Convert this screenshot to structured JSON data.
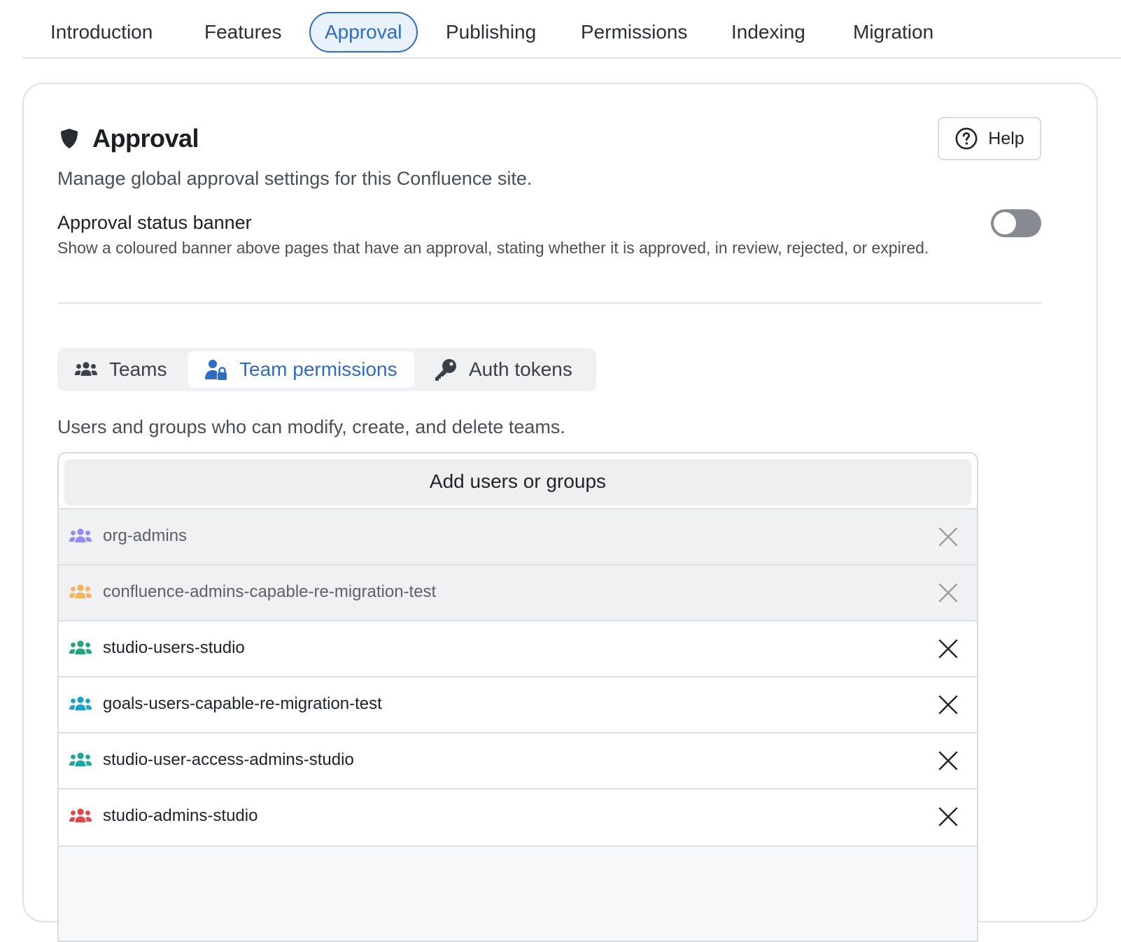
{
  "nav": {
    "tabs": [
      {
        "label": "Introduction"
      },
      {
        "label": "Features"
      },
      {
        "label": "Approval",
        "active": true
      },
      {
        "label": "Publishing"
      },
      {
        "label": "Permissions"
      },
      {
        "label": "Indexing"
      },
      {
        "label": "Migration"
      }
    ]
  },
  "header": {
    "title": "Approval",
    "title_icon": "shield-icon",
    "help_label": "Help",
    "help_icon": "question-circle-icon",
    "subtitle": "Manage global approval settings for this Confluence site."
  },
  "banner_setting": {
    "title": "Approval status banner",
    "description": "Show a coloured banner above pages that have an approval, stating whether it is approved, in review, rejected, or expired.",
    "enabled": false
  },
  "subtabs": [
    {
      "label": "Teams",
      "icon": "users-icon",
      "active": false
    },
    {
      "label": "Team permissions",
      "icon": "user-lock-icon",
      "active": true
    },
    {
      "label": "Auth tokens",
      "icon": "key-icon",
      "active": false
    }
  ],
  "permissions": {
    "description": "Users and groups who can modify, create, and delete teams.",
    "add_label": "Add users or groups",
    "groups": [
      {
        "name": "org-admins",
        "color": "#8f8ef0",
        "locked": true
      },
      {
        "name": "confluence-admins-capable-re-migration-test",
        "color": "#f5b35c",
        "locked": true
      },
      {
        "name": "studio-users-studio",
        "color": "#1fa67a",
        "locked": false
      },
      {
        "name": "goals-users-capable-re-migration-test",
        "color": "#1aa3c4",
        "locked": false
      },
      {
        "name": "studio-user-access-admins-studio",
        "color": "#1fa6a0",
        "locked": false
      },
      {
        "name": "studio-admins-studio",
        "color": "#e0474c",
        "locked": false
      }
    ]
  },
  "colors": {
    "accent": "#2d6cc4",
    "toggle_off": "#878b91"
  }
}
